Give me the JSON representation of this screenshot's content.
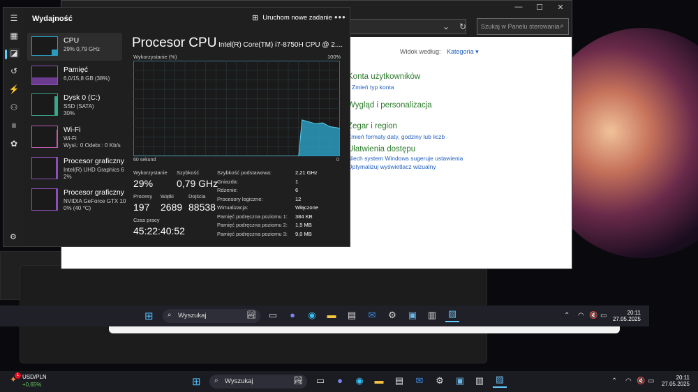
{
  "task_manager": {
    "title": "Wydajność",
    "new_task_label": "Uruchom nowe zadanie",
    "more_label": "•••",
    "sidebar": [
      {
        "name": "CPU",
        "detail": "29% 0,79 GHz",
        "detail2": ""
      },
      {
        "name": "Pamięć",
        "detail": "6,0/15,8 GB (38%)",
        "detail2": ""
      },
      {
        "name": "Dysk 0 (C:)",
        "detail": "SSD (SATA)",
        "detail2": "30%"
      },
      {
        "name": "Wi-Fi",
        "detail": "Wi-Fi",
        "detail2": "Wysł.: 0 Odebr.: 0 Kb/s"
      },
      {
        "name": "Procesor graficzny",
        "detail": "Intel(R) UHD Graphics 6",
        "detail2": "2%"
      },
      {
        "name": "Procesor graficzny",
        "detail": "NVIDIA GeForce GTX 10",
        "detail2": "0% (40 °C)"
      }
    ],
    "main": {
      "title": "Procesor CPU",
      "model": "Intel(R) Core(TM) i7-8750H CPU @ 2....",
      "util_label": "Wykorzystanie (%)",
      "util_max": "100%",
      "axis_left": "60 sekund",
      "axis_right": "0",
      "stats": {
        "utilization_label": "Wykorzystanie",
        "utilization": "29%",
        "speed_label": "Szybkość",
        "speed": "0,79 GHz",
        "processes_label": "Procesy",
        "processes": "197",
        "threads_label": "Wątki",
        "threads": "2689",
        "handles_label": "Dojścia",
        "handles": "88538",
        "uptime_label": "Czas pracy",
        "uptime": "45:22:40:52"
      },
      "specs": [
        {
          "k": "Szybkość podstawowa:",
          "v": "2,21 GHz"
        },
        {
          "k": "Gniazda:",
          "v": "1"
        },
        {
          "k": "Rdzenie:",
          "v": "6"
        },
        {
          "k": "Procesory logiczne:",
          "v": "12"
        },
        {
          "k": "Wirtualizacja:",
          "v": "Włączone"
        },
        {
          "k": "Pamięć podręczna poziomu 1:",
          "v": "384 KB"
        },
        {
          "k": "Pamięć podręczna poziomu 2:",
          "v": "1,5 MB"
        },
        {
          "k": "Pamięć podręczna poziomu 3:",
          "v": "9,0 MB"
        }
      ]
    },
    "icons": [
      "hamburger-icon",
      "processes-icon",
      "performance-icon",
      "history-icon",
      "startup-icon",
      "users-icon",
      "details-icon",
      "services-icon",
      "settings-icon"
    ],
    "accent_color": "#60cdff",
    "graph_color": "#2b9bbd"
  },
  "chart_data": {
    "type": "area",
    "x": [
      60,
      54,
      48,
      42,
      36,
      30,
      24,
      18,
      14,
      12,
      11,
      9,
      7,
      5,
      3,
      1,
      0
    ],
    "values": [
      0,
      0,
      0,
      0,
      0,
      0,
      0,
      0,
      0,
      0,
      38,
      36,
      34,
      35,
      31,
      30,
      29
    ],
    "ylim": [
      0,
      100
    ],
    "grid": true
  },
  "control_panel": {
    "search_placeholder": "Szukaj w Panelu sterowania",
    "view_label": "Widok według:",
    "view_value": "Kategoria",
    "sections": [
      {
        "head": "Konta użytkowników",
        "links": [
          "Zmień typ konta"
        ]
      },
      {
        "head": "Wygląd i personalizacja",
        "links": []
      },
      {
        "head": "Zegar i region",
        "links": [
          "Zmień formaty daty, godziny lub liczb"
        ]
      },
      {
        "head": "Ułatwienia dostępu",
        "links": [
          "Niech system Windows sugeruje ustawienia",
          "Optymalizuj wyświetlacz wizualny"
        ]
      }
    ]
  },
  "taskbar": {
    "search_label": "Wyszukaj",
    "time": "20:11",
    "date": "27.05.2025",
    "widget_title": "USD/PLN",
    "widget_value": "+0,65%",
    "widget_badge": "1",
    "apps": [
      "task-view-icon",
      "teams-icon",
      "edge-icon",
      "explorer-icon",
      "store-icon",
      "mail-icon",
      "settings-icon",
      "control-panel-icon",
      "network-icon",
      "task-manager-icon"
    ]
  }
}
